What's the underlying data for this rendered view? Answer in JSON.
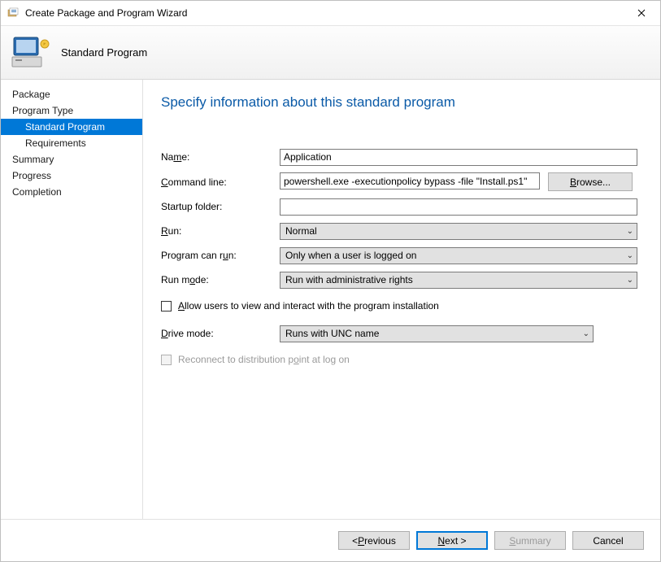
{
  "window": {
    "title": "Create Package and Program Wizard",
    "banner_title": "Standard Program"
  },
  "sidebar": {
    "items": [
      {
        "label": "Package",
        "indent": false,
        "selected": false
      },
      {
        "label": "Program Type",
        "indent": false,
        "selected": false
      },
      {
        "label": "Standard Program",
        "indent": true,
        "selected": true
      },
      {
        "label": "Requirements",
        "indent": true,
        "selected": false
      },
      {
        "label": "Summary",
        "indent": false,
        "selected": false
      },
      {
        "label": "Progress",
        "indent": false,
        "selected": false
      },
      {
        "label": "Completion",
        "indent": false,
        "selected": false
      }
    ]
  },
  "page": {
    "title": "Specify information about this standard program",
    "labels": {
      "name_pre": "Na",
      "name_u": "m",
      "name_post": "e:",
      "cmd_u": "C",
      "cmd_post": "ommand line:",
      "startup": "Startup folder:",
      "run_u": "R",
      "run_post": "un:",
      "canrun_pre": "Program can r",
      "canrun_u": "u",
      "canrun_post": "n:",
      "mode_pre": "Run m",
      "mode_u": "o",
      "mode_post": "de:",
      "allow_u": "A",
      "allow_post": "llow users to view and interact with the program installation",
      "drive_u": "D",
      "drive_post": "rive mode:",
      "reconnect_pre": "Reconnect to distribution p",
      "reconnect_u": "o",
      "reconnect_post": "int at log on",
      "browse_u": "B",
      "browse_post": "rowse..."
    },
    "values": {
      "name": "Application",
      "command_line": "powershell.exe -executionpolicy bypass -file \"Install.ps1\"",
      "startup_folder": "",
      "run": "Normal",
      "program_can_run": "Only when a user is logged on",
      "run_mode": "Run with administrative rights",
      "drive_mode": "Runs with UNC name",
      "allow_users": false,
      "reconnect": false
    }
  },
  "footer": {
    "previous_pre": "< ",
    "previous_u": "P",
    "previous_post": "revious",
    "next_u": "N",
    "next_post": "ext >",
    "summary_u": "S",
    "summary_post": "ummary",
    "cancel": "Cancel"
  }
}
